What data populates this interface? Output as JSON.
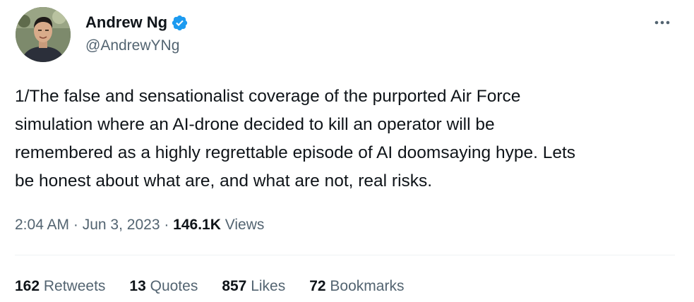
{
  "author": {
    "display_name": "Andrew Ng",
    "handle": "@AndrewYNg",
    "verified": true
  },
  "tweet": {
    "text": "1/The false and sensationalist coverage of the purported Air Force\nsimulation where an AI-drone decided to kill an operator will be\nremembered as a highly regrettable episode of AI doomsaying hype. Lets\nbe honest about what are, and what are not, real risks."
  },
  "meta": {
    "time": "2:04 AM",
    "separator1": " · ",
    "date": "Jun 3, 2023",
    "separator2": " · ",
    "views_count": "146.1K",
    "views_label": " Views"
  },
  "stats": {
    "retweets_count": "162",
    "retweets_label": " Retweets",
    "quotes_count": "13",
    "quotes_label": " Quotes",
    "likes_count": "857",
    "likes_label": " Likes",
    "bookmarks_count": "72",
    "bookmarks_label": " Bookmarks"
  },
  "icons": {
    "verified": "verified-badge-icon",
    "more": "more-options-icon"
  },
  "colors": {
    "verified": "#1d9bf0",
    "primary_text": "#0f1419",
    "secondary_text": "#536471",
    "divider": "#eff3f4"
  }
}
